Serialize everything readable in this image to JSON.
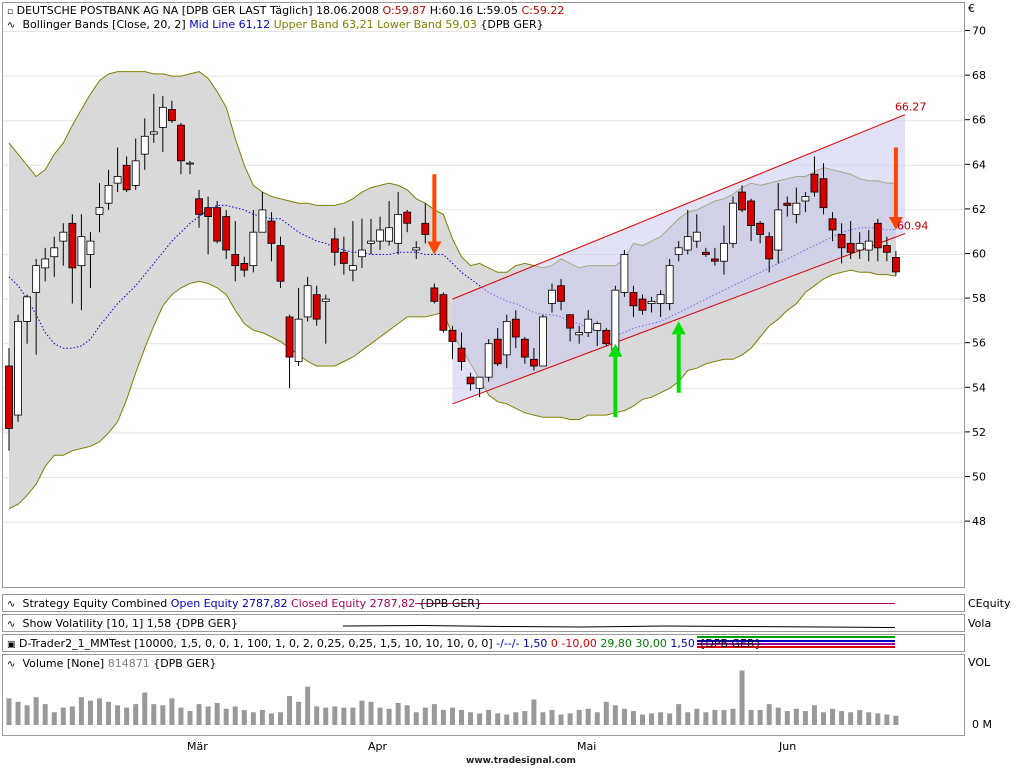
{
  "header": {
    "symbol_line": "DEUTSCHE POSTBANK AG NA [DPB GER LAST Täglich] 18.06.2008",
    "ohlc": {
      "o": "O:59.87",
      "h": "H:60.16",
      "l": "L:59.05",
      "c": "C:59.22"
    },
    "bollinger_label": "Bollinger Bands [Close, 20, 2]",
    "mid_line": "Mid Line 61,12",
    "upper_band": "Upper Band 63,21",
    "lower_band": "Lower Band 59,03",
    "bb_symbol": "{DPB GER}",
    "currency": "€"
  },
  "panels": {
    "equity": {
      "prefix": "Strategy Equity Combined",
      "open": "Open Equity 2787,82",
      "closed": "Closed Equity 2787,82",
      "symbol": "{DPB GER}",
      "right_label": "CEquity"
    },
    "volatility": {
      "text": "Show Volatility [10, 1] 1,58 {DPB GER}",
      "right_label": "Vola"
    },
    "trader": {
      "prefix": "D-Trader2_1_MMTest [10000, 1,5, 0, 0, 1, 100, 1, 0, 2, 0,25, 0,25, 1,5, 10, 10, 10, 0, 0]",
      "v1": "-/--/- 1,50",
      "v2": "0 -10,00",
      "v3": "29,80 30,00",
      "v4": "1,50",
      "symbol": "{DPB GER}"
    },
    "volume": {
      "prefix": "Volume [None]",
      "value": "814871",
      "symbol": "{DPB GER}",
      "right_label": "VOL",
      "zero_label": "0 M"
    }
  },
  "x_months": [
    "Mär",
    "Apr",
    "Mai",
    "Jun"
  ],
  "watermark": "www.tradesignal.com",
  "annotations": {
    "channel_top": "66.27",
    "channel_bottom": "60.94"
  },
  "colors": {
    "up": "#ffffff",
    "down": "#d40000",
    "band_fill": "#d9d9d9",
    "band_line": "#808000",
    "mid_line": "#0000ff",
    "channel": "#e00000",
    "channel_fill": "#c8c8f0",
    "sell_arrow": "#ff4500",
    "buy_arrow": "#00e000"
  },
  "chart_data": {
    "type": "candlestick",
    "title": "DEUTSCHE POSTBANK AG NA",
    "ylim": [
      47,
      71
    ],
    "y_ticks": [
      48,
      50,
      52,
      54,
      56,
      58,
      60,
      62,
      64,
      66,
      68,
      70
    ],
    "x_categories_months": [
      "Mär",
      "Apr",
      "Mai",
      "Jun"
    ],
    "candles": [
      {
        "o": 55.0,
        "h": 55.8,
        "l": 51.2,
        "c": 52.2
      },
      {
        "o": 52.8,
        "h": 57.3,
        "l": 52.5,
        "c": 57.0
      },
      {
        "o": 57.0,
        "h": 58.2,
        "l": 56.0,
        "c": 58.1
      },
      {
        "o": 58.3,
        "h": 59.8,
        "l": 55.5,
        "c": 59.5
      },
      {
        "o": 59.4,
        "h": 60.3,
        "l": 58.8,
        "c": 59.8
      },
      {
        "o": 59.9,
        "h": 60.8,
        "l": 59.0,
        "c": 60.3
      },
      {
        "o": 60.6,
        "h": 61.4,
        "l": 59.5,
        "c": 61.0
      },
      {
        "o": 61.4,
        "h": 61.8,
        "l": 57.8,
        "c": 59.4
      },
      {
        "o": 59.5,
        "h": 61.8,
        "l": 57.5,
        "c": 60.8
      },
      {
        "o": 60.0,
        "h": 61.0,
        "l": 58.5,
        "c": 60.6
      },
      {
        "o": 61.8,
        "h": 63.2,
        "l": 61.0,
        "c": 62.1
      },
      {
        "o": 62.3,
        "h": 63.8,
        "l": 62.0,
        "c": 63.1
      },
      {
        "o": 63.2,
        "h": 64.8,
        "l": 62.8,
        "c": 63.5
      },
      {
        "o": 64.0,
        "h": 64.4,
        "l": 62.8,
        "c": 62.9
      },
      {
        "o": 63.1,
        "h": 65.2,
        "l": 62.9,
        "c": 64.2
      },
      {
        "o": 64.5,
        "h": 66.1,
        "l": 63.8,
        "c": 65.3
      },
      {
        "o": 65.4,
        "h": 67.2,
        "l": 65.0,
        "c": 65.5
      },
      {
        "o": 65.7,
        "h": 67.1,
        "l": 64.6,
        "c": 66.6
      },
      {
        "o": 66.5,
        "h": 66.9,
        "l": 65.9,
        "c": 66.0
      },
      {
        "o": 65.8,
        "h": 65.9,
        "l": 63.6,
        "c": 64.2
      },
      {
        "o": 64.1,
        "h": 64.2,
        "l": 63.6,
        "c": 64.1
      },
      {
        "o": 62.5,
        "h": 62.9,
        "l": 61.2,
        "c": 61.8
      },
      {
        "o": 62.1,
        "h": 62.6,
        "l": 60.0,
        "c": 61.7
      },
      {
        "o": 62.1,
        "h": 62.4,
        "l": 60.5,
        "c": 60.6
      },
      {
        "o": 61.7,
        "h": 62.0,
        "l": 59.8,
        "c": 60.2
      },
      {
        "o": 60.0,
        "h": 61.5,
        "l": 58.8,
        "c": 59.5
      },
      {
        "o": 59.6,
        "h": 59.9,
        "l": 59.0,
        "c": 59.3
      },
      {
        "o": 59.5,
        "h": 62.0,
        "l": 59.2,
        "c": 61.0
      },
      {
        "o": 61.0,
        "h": 62.8,
        "l": 61.0,
        "c": 62.0
      },
      {
        "o": 61.5,
        "h": 61.9,
        "l": 59.7,
        "c": 60.5
      },
      {
        "o": 60.4,
        "h": 60.8,
        "l": 58.5,
        "c": 58.8
      },
      {
        "o": 57.2,
        "h": 57.3,
        "l": 54.0,
        "c": 55.4
      },
      {
        "o": 55.2,
        "h": 58.5,
        "l": 55.0,
        "c": 57.1
      },
      {
        "o": 57.2,
        "h": 59.0,
        "l": 57.0,
        "c": 58.6
      },
      {
        "o": 58.2,
        "h": 58.6,
        "l": 56.8,
        "c": 57.1
      },
      {
        "o": 57.9,
        "h": 58.2,
        "l": 56.0,
        "c": 58.0
      },
      {
        "o": 60.7,
        "h": 61.2,
        "l": 59.5,
        "c": 60.1
      },
      {
        "o": 60.1,
        "h": 60.8,
        "l": 59.1,
        "c": 59.6
      },
      {
        "o": 59.3,
        "h": 61.5,
        "l": 58.8,
        "c": 59.5
      },
      {
        "o": 59.9,
        "h": 61.6,
        "l": 59.4,
        "c": 60.2
      },
      {
        "o": 60.5,
        "h": 61.6,
        "l": 60.0,
        "c": 60.6
      },
      {
        "o": 60.6,
        "h": 61.7,
        "l": 60.2,
        "c": 61.1
      },
      {
        "o": 60.6,
        "h": 62.4,
        "l": 60.4,
        "c": 61.2
      },
      {
        "o": 60.5,
        "h": 62.8,
        "l": 60.0,
        "c": 61.8
      },
      {
        "o": 61.9,
        "h": 62.0,
        "l": 61.0,
        "c": 61.4
      },
      {
        "o": 60.2,
        "h": 60.6,
        "l": 59.8,
        "c": 60.3
      },
      {
        "o": 61.4,
        "h": 62.3,
        "l": 60.5,
        "c": 60.9
      },
      {
        "o": 58.5,
        "h": 58.7,
        "l": 57.8,
        "c": 57.9
      },
      {
        "o": 58.2,
        "h": 58.3,
        "l": 56.5,
        "c": 56.6
      },
      {
        "o": 56.6,
        "h": 56.8,
        "l": 55.3,
        "c": 56.1
      },
      {
        "o": 55.8,
        "h": 56.5,
        "l": 54.8,
        "c": 55.2
      },
      {
        "o": 54.5,
        "h": 54.7,
        "l": 53.9,
        "c": 54.2
      },
      {
        "o": 54.0,
        "h": 54.5,
        "l": 53.6,
        "c": 54.5
      },
      {
        "o": 54.5,
        "h": 56.2,
        "l": 54.3,
        "c": 56.0
      },
      {
        "o": 56.2,
        "h": 56.7,
        "l": 55.0,
        "c": 55.1
      },
      {
        "o": 55.5,
        "h": 57.3,
        "l": 54.9,
        "c": 57.0
      },
      {
        "o": 57.1,
        "h": 57.5,
        "l": 55.8,
        "c": 56.3
      },
      {
        "o": 56.2,
        "h": 56.3,
        "l": 55.1,
        "c": 55.4
      },
      {
        "o": 55.3,
        "h": 55.8,
        "l": 54.8,
        "c": 55.0
      },
      {
        "o": 55.0,
        "h": 57.3,
        "l": 55.0,
        "c": 57.2
      },
      {
        "o": 57.8,
        "h": 58.7,
        "l": 57.4,
        "c": 58.4
      },
      {
        "o": 58.6,
        "h": 58.9,
        "l": 57.5,
        "c": 57.9
      },
      {
        "o": 57.3,
        "h": 57.3,
        "l": 56.1,
        "c": 56.7
      },
      {
        "o": 56.4,
        "h": 56.8,
        "l": 56.0,
        "c": 56.5
      },
      {
        "o": 56.5,
        "h": 57.5,
        "l": 56.3,
        "c": 57.1
      },
      {
        "o": 56.6,
        "h": 57.0,
        "l": 55.9,
        "c": 56.9
      },
      {
        "o": 56.6,
        "h": 56.7,
        "l": 55.9,
        "c": 56.0
      },
      {
        "o": 55.7,
        "h": 58.6,
        "l": 55.7,
        "c": 58.4
      },
      {
        "o": 58.3,
        "h": 60.2,
        "l": 58.1,
        "c": 60.0
      },
      {
        "o": 58.3,
        "h": 58.6,
        "l": 57.2,
        "c": 57.7
      },
      {
        "o": 58.0,
        "h": 58.2,
        "l": 57.3,
        "c": 57.5
      },
      {
        "o": 57.8,
        "h": 58.1,
        "l": 57.4,
        "c": 57.9
      },
      {
        "o": 57.8,
        "h": 58.4,
        "l": 57.2,
        "c": 58.2
      },
      {
        "o": 57.8,
        "h": 59.8,
        "l": 57.5,
        "c": 59.5
      },
      {
        "o": 60.0,
        "h": 60.6,
        "l": 59.7,
        "c": 60.3
      },
      {
        "o": 60.2,
        "h": 62.0,
        "l": 60.0,
        "c": 60.8
      },
      {
        "o": 60.6,
        "h": 61.8,
        "l": 60.3,
        "c": 61.0
      },
      {
        "o": 60.1,
        "h": 60.3,
        "l": 59.9,
        "c": 60.0
      },
      {
        "o": 59.8,
        "h": 60.3,
        "l": 59.5,
        "c": 59.7
      },
      {
        "o": 59.7,
        "h": 61.3,
        "l": 59.1,
        "c": 60.5
      },
      {
        "o": 60.5,
        "h": 62.6,
        "l": 60.3,
        "c": 62.3
      },
      {
        "o": 62.8,
        "h": 63.1,
        "l": 61.9,
        "c": 62.0
      },
      {
        "o": 62.4,
        "h": 62.5,
        "l": 60.6,
        "c": 61.3
      },
      {
        "o": 61.4,
        "h": 61.5,
        "l": 60.5,
        "c": 60.9
      },
      {
        "o": 60.8,
        "h": 61.0,
        "l": 59.2,
        "c": 59.8
      },
      {
        "o": 60.2,
        "h": 63.2,
        "l": 59.6,
        "c": 62.0
      },
      {
        "o": 62.3,
        "h": 62.6,
        "l": 61.7,
        "c": 62.2
      },
      {
        "o": 61.8,
        "h": 63.0,
        "l": 61.4,
        "c": 62.3
      },
      {
        "o": 62.4,
        "h": 62.8,
        "l": 61.9,
        "c": 62.6
      },
      {
        "o": 63.6,
        "h": 64.4,
        "l": 62.6,
        "c": 62.8
      },
      {
        "o": 63.4,
        "h": 64.1,
        "l": 61.8,
        "c": 62.1
      },
      {
        "o": 61.6,
        "h": 61.9,
        "l": 60.6,
        "c": 61.1
      },
      {
        "o": 60.9,
        "h": 61.4,
        "l": 59.6,
        "c": 60.3
      },
      {
        "o": 60.5,
        "h": 61.5,
        "l": 59.8,
        "c": 60.1
      },
      {
        "o": 60.2,
        "h": 61.0,
        "l": 59.8,
        "c": 60.5
      },
      {
        "o": 60.2,
        "h": 61.1,
        "l": 59.7,
        "c": 60.6
      },
      {
        "o": 61.4,
        "h": 61.6,
        "l": 59.7,
        "c": 60.3
      },
      {
        "o": 60.4,
        "h": 60.8,
        "l": 59.7,
        "c": 60.1
      },
      {
        "o": 59.87,
        "h": 60.16,
        "l": 59.05,
        "c": 59.22
      }
    ],
    "bollinger": {
      "upper": [
        65,
        64.5,
        64,
        63.5,
        63.8,
        64.5,
        65,
        65.8,
        66.5,
        67.2,
        67.8,
        68.1,
        68.2,
        68.2,
        68.2,
        68.2,
        68.1,
        68.1,
        68.0,
        68.0,
        68.1,
        68.2,
        67.9,
        67.3,
        66.6,
        65.2,
        64.0,
        63.1,
        62.8,
        62.6,
        62.5,
        62.4,
        62.3,
        62.3,
        62.2,
        62.2,
        62.2,
        62.3,
        62.5,
        62.8,
        63.0,
        63.1,
        63.2,
        63.1,
        62.9,
        62.5,
        62.3,
        62.0,
        61.8,
        60.7,
        59.9,
        59.5,
        59.6,
        59.4,
        59.2,
        59.2,
        59.5,
        59.6,
        59.5,
        59.4,
        59.5,
        59.8,
        59.6,
        59.4,
        59.5,
        59.5,
        59.5,
        59.5,
        59.8,
        60.5,
        60.4,
        60.6,
        60.8,
        61.2,
        61.6,
        61.9,
        62.0,
        62.2,
        62.4,
        62.5,
        62.7,
        63.0,
        63.2,
        63.1,
        63.2,
        63.3,
        63.4,
        63.5,
        63.5,
        63.7,
        63.9,
        63.8,
        63.7,
        63.6,
        63.4,
        63.3,
        63.3,
        63.2,
        63.2
      ],
      "mid": [
        59,
        58.6,
        58.0,
        57.3,
        56.5,
        56.0,
        55.8,
        55.8,
        55.9,
        56.2,
        56.8,
        57.3,
        57.8,
        58.2,
        58.6,
        59.1,
        59.6,
        60.1,
        60.6,
        61.0,
        61.4,
        61.7,
        62.0,
        62.2,
        62.2,
        62.1,
        62.0,
        61.8,
        61.7,
        61.6,
        61.6,
        61.3,
        61.0,
        60.8,
        60.6,
        60.5,
        60.3,
        60.2,
        60.1,
        60.1,
        60.0,
        60.0,
        60.0,
        60.1,
        60.1,
        60.1,
        60.0,
        60.0,
        60.0,
        59.6,
        59.2,
        58.9,
        58.6,
        58.3,
        58.1,
        57.9,
        57.8,
        57.6,
        57.4,
        57.3,
        57.3,
        57.2,
        57.0,
        56.9,
        56.7,
        56.6,
        56.5,
        56.4,
        56.5,
        56.7,
        56.8,
        56.9,
        57.0,
        57.2,
        57.4,
        57.6,
        57.8,
        58.0,
        58.2,
        58.4,
        58.6,
        58.8,
        59.0,
        59.2,
        59.4,
        59.6,
        59.8,
        60.0,
        60.2,
        60.4,
        60.6,
        60.8,
        61.0,
        61.1,
        61.2,
        61.2,
        61.2,
        61.1,
        61.12
      ],
      "lower": [
        48.6,
        48.8,
        49.2,
        49.7,
        50.5,
        51.0,
        51.0,
        51.2,
        51.3,
        51.4,
        51.6,
        52.0,
        52.5,
        53.5,
        54.7,
        55.8,
        56.8,
        57.7,
        58.2,
        58.5,
        58.7,
        58.8,
        58.7,
        58.5,
        58.2,
        57.5,
        56.9,
        56.6,
        56.5,
        56.3,
        56.1,
        55.8,
        55.5,
        55.2,
        55.0,
        55.0,
        55.0,
        55.2,
        55.4,
        55.7,
        56.0,
        56.3,
        56.6,
        56.9,
        57.2,
        57.2,
        57.2,
        57.3,
        57.4,
        56.4,
        55.8,
        55.1,
        54.4,
        53.7,
        53.4,
        53.3,
        53.1,
        52.9,
        52.8,
        52.7,
        52.7,
        52.7,
        52.6,
        52.6,
        52.8,
        52.8,
        52.8,
        52.9,
        53.0,
        53.2,
        53.5,
        53.6,
        53.8,
        54.0,
        54.3,
        54.8,
        54.9,
        55.1,
        55.2,
        55.3,
        55.3,
        55.5,
        55.8,
        56.3,
        56.8,
        57.1,
        57.5,
        57.8,
        58.3,
        58.6,
        58.9,
        59.1,
        59.2,
        59.3,
        59.2,
        59.2,
        59.1,
        59.1,
        59.03
      ]
    },
    "channel": {
      "upper": {
        "from": {
          "bar": 49,
          "price": 58.0
        },
        "to": {
          "bar": 99,
          "price": 66.27
        }
      },
      "lower": {
        "from": {
          "bar": 49,
          "price": 53.3
        },
        "to": {
          "bar": 99,
          "price": 60.94
        }
      }
    },
    "arrows": [
      {
        "kind": "sell",
        "bar": 47,
        "from": 63.6,
        "to": 60.0
      },
      {
        "kind": "buy",
        "bar": 67,
        "from": 52.7,
        "to": 56.0
      },
      {
        "kind": "buy",
        "bar": 74,
        "from": 53.8,
        "to": 57.0
      },
      {
        "kind": "sell",
        "bar": 98,
        "from": 64.8,
        "to": 61.1
      }
    ],
    "volume": [
      2.3,
      2.0,
      1.7,
      2.4,
      1.8,
      1.1,
      1.5,
      1.6,
      2.4,
      2.1,
      2.3,
      2.0,
      1.7,
      1.5,
      1.8,
      2.8,
      1.8,
      1.7,
      2.3,
      1.5,
      1.2,
      1.8,
      1.6,
      1.9,
      1.4,
      1.6,
      1.3,
      1.1,
      1.3,
      1.0,
      1.1,
      2.5,
      2.0,
      3.3,
      1.6,
      1.5,
      1.6,
      1.5,
      1.5,
      2.1,
      2.0,
      1.5,
      1.4,
      1.9,
      1.7,
      1.1,
      1.5,
      1.8,
      1.3,
      1.5,
      1.3,
      1.1,
      1.0,
      1.3,
      1.0,
      0.9,
      1.1,
      1.2,
      2.2,
      1.1,
      1.3,
      0.9,
      1.0,
      1.3,
      1.4,
      1.1,
      2.0,
      1.7,
      1.4,
      1.2,
      0.9,
      1.0,
      1.1,
      1.0,
      1.8,
      1.1,
      1.4,
      1.1,
      1.3,
      1.3,
      1.4,
      4.7,
      1.3,
      1.3,
      1.8,
      1.5,
      1.2,
      1.4,
      1.2,
      1.7,
      1.1,
      1.4,
      1.2,
      1.1,
      1.3,
      1.1,
      1.0,
      0.9,
      0.8
    ]
  }
}
